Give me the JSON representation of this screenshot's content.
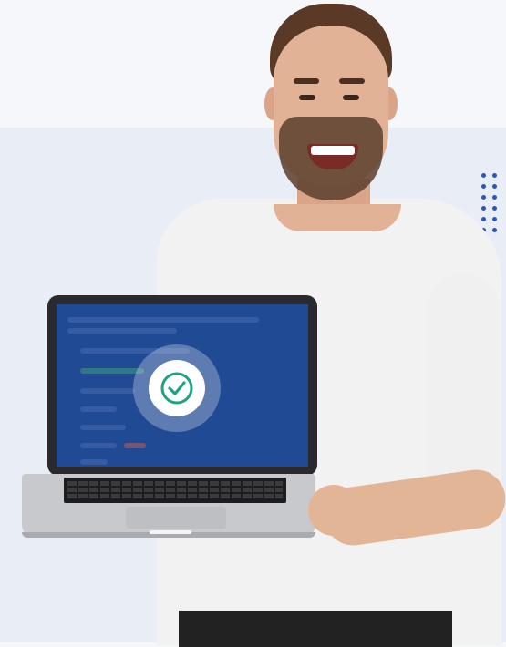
{
  "scene": {
    "subject": "smiling-man-holding-laptop",
    "status_icon": "checkmark-circle-icon",
    "colors": {
      "background": "#f4f6fa",
      "panel": "#e9edf6",
      "accent_dots": "#2b56b8",
      "screen": "#214a94",
      "check": "#1fa183",
      "shirt": "#f2f2f3"
    }
  }
}
